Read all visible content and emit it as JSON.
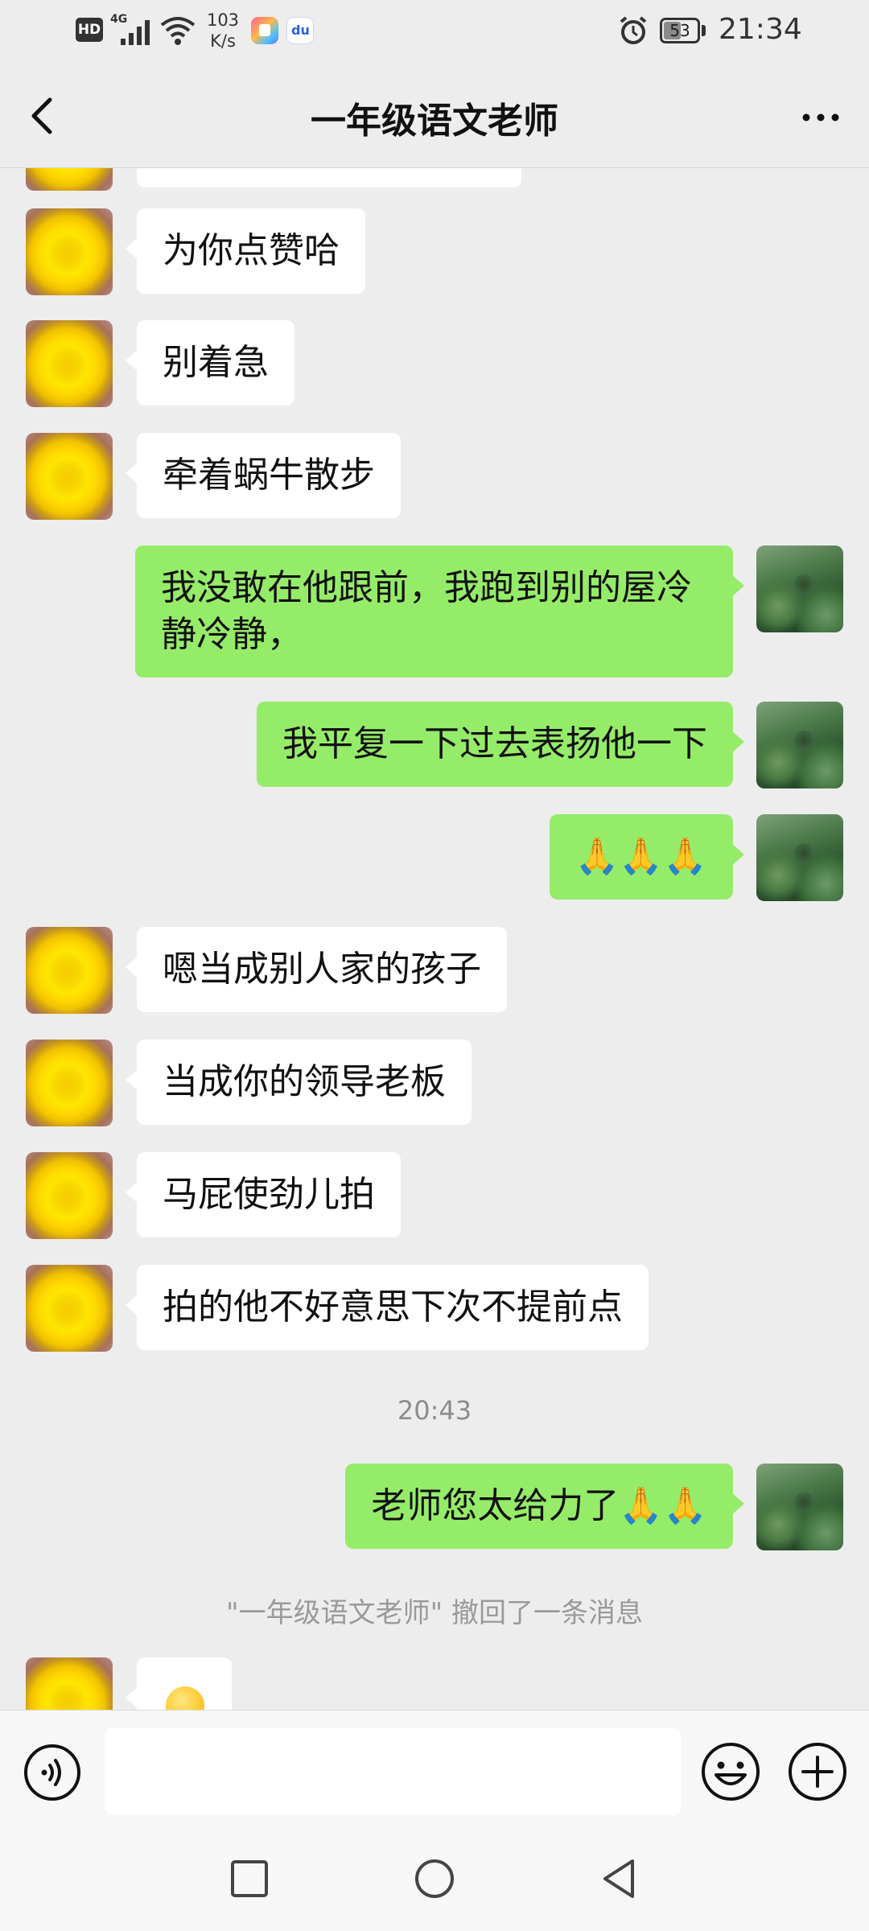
{
  "status_bar": {
    "hd": "HD",
    "network": "4G",
    "speed_value": "103",
    "speed_unit": "K/s",
    "battery": "53",
    "battery_level": 0.53,
    "time": "21:34"
  },
  "header": {
    "title": "一年级语文老师"
  },
  "messages": [
    {
      "side": "in",
      "text": "为你点赞哈"
    },
    {
      "side": "in",
      "text": "别着急"
    },
    {
      "side": "in",
      "text": "牵着蜗牛散步"
    },
    {
      "side": "out",
      "text": "我没敢在他跟前，我跑到别的屋冷静冷静，"
    },
    {
      "side": "out",
      "text": "我平复一下过去表扬他一下"
    },
    {
      "side": "out",
      "text": "🙏🙏🙏"
    },
    {
      "side": "in",
      "text": "嗯当成别人家的孩子"
    },
    {
      "side": "in",
      "text": "当成你的领导老板"
    },
    {
      "side": "in",
      "text": "马屁使劲儿拍"
    },
    {
      "side": "in",
      "text": "拍的他不好意思下次不提前点"
    },
    {
      "side": "out",
      "text": "老师您太给力了🙏🙏"
    }
  ],
  "timestamp": "20:43",
  "recall_notice": "\"一年级语文老师\" 撤回了一条消息",
  "colors": {
    "background": "#ededed",
    "outgoing_bubble": "#95ec69",
    "incoming_bubble": "#ffffff"
  },
  "icons": {
    "back": "chevron-left-icon",
    "more": "more-horizontal-icon",
    "voice": "voice-icon",
    "emoji": "emoji-icon",
    "plus": "plus-icon"
  }
}
